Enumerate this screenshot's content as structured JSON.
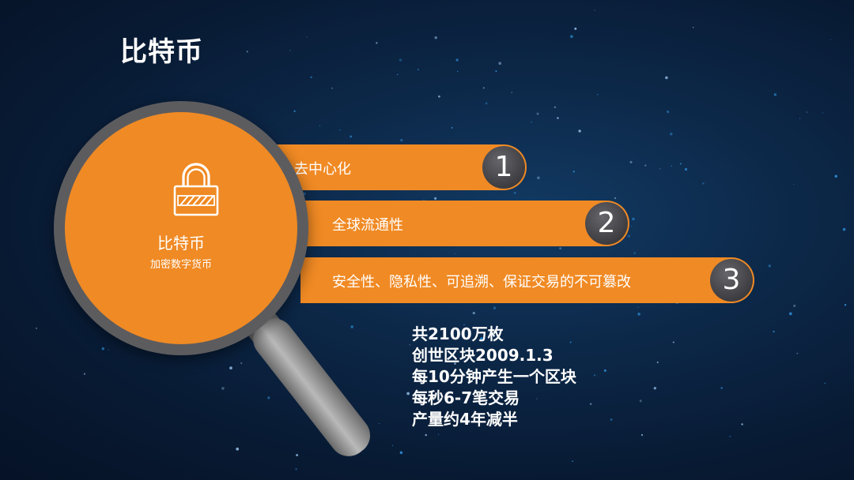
{
  "title": "比特币",
  "lens": {
    "icon": "lock-icon",
    "title": "比特币",
    "subtitle": "加密数字货币"
  },
  "features": [
    {
      "label": "去中心化",
      "number": "1"
    },
    {
      "label": "全球流通性",
      "number": "2"
    },
    {
      "label": "安全性、隐私性、可追溯、保证交易的不可篡改",
      "number": "3"
    }
  ],
  "facts": [
    "共2100万枚",
    "创世区块2009.1.3",
    "每10分钟产生一个区块",
    "每秒6-7笔交易",
    "产量约4年减半"
  ],
  "colors": {
    "accent": "#f08a24",
    "badge": "#3d3d41",
    "background": "#0a2040"
  }
}
